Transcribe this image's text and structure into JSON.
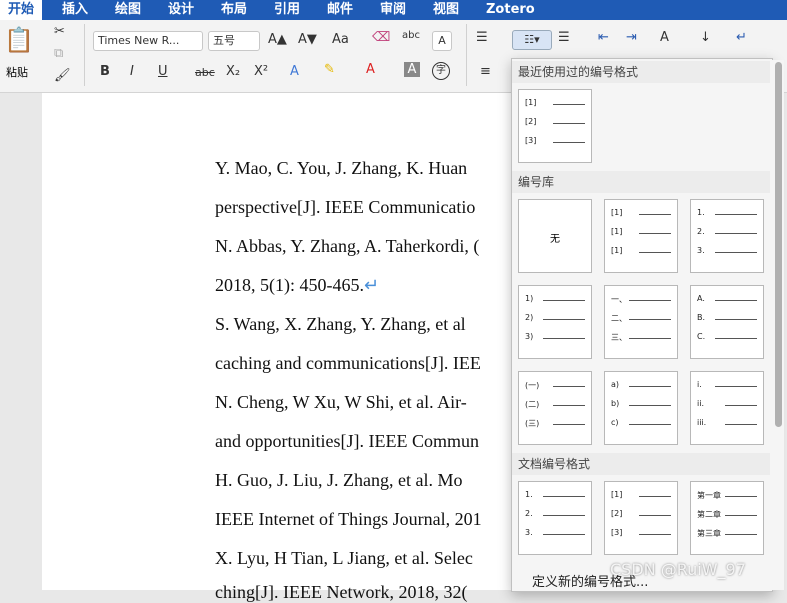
{
  "menu": {
    "tabs": [
      "开始",
      "插入",
      "绘图",
      "设计",
      "布局",
      "引用",
      "邮件",
      "审阅",
      "视图",
      "Zotero"
    ]
  },
  "ribbon": {
    "paste_label": "粘贴",
    "font_name": "Times New R...",
    "font_size": "五号",
    "bold": "B",
    "italic": "I",
    "underline": "U",
    "strike": "abc",
    "subscript": "X₂",
    "superscript": "X²",
    "grow": "A▲",
    "shrink": "A▼",
    "case": "Aa",
    "phonetic": "字"
  },
  "document": {
    "lines": [
      "Y. Mao, C. You, J. Zhang, K. Huan",
      "perspective[J]. IEEE Communicatio",
      "N. Abbas, Y. Zhang, A. Taherkordi, (",
      "2018, 5(1): 450-465.",
      "S. Wang, X. Zhang, Y. Zhang, et al",
      "caching and communications[J]. IEE",
      "N. Cheng, W Xu, W Shi, et al. Air-",
      "and opportunities[J]. IEEE Commun",
      "H. Guo, J. Liu, J. Zhang, et al. Mo",
      "IEEE Internet of Things Journal, 201",
      "X. Lyu, H Tian, L Jiang, et al. Selec",
      "ching[J]. IEEE Network, 2018, 32("
    ],
    "return_mark": "↵"
  },
  "dropdown": {
    "recent_title": "最近使用过的编号格式",
    "library_title": "编号库",
    "doc_title": "文档编号格式",
    "none_label": "无",
    "define_new": "定义新的编号格式...",
    "recent": [
      [
        "[1]",
        "[2]",
        "[3]"
      ]
    ],
    "library": [
      [
        "[1]",
        "[1]",
        "[1]"
      ],
      [
        "1.",
        "2.",
        "3."
      ],
      [
        "1)",
        "2)",
        "3)"
      ],
      [
        "一、",
        "二、",
        "三、"
      ],
      [
        "A.",
        "B.",
        "C."
      ],
      [
        "(一)",
        "(二)",
        "(三)"
      ],
      [
        "a)",
        "b)",
        "c)"
      ],
      [
        "i.",
        "ii.",
        "iii."
      ]
    ],
    "docformats": [
      [
        "1.",
        "2.",
        "3."
      ],
      [
        "[1]",
        "[2]",
        "[3]"
      ],
      [
        "第一章",
        "第二章",
        "第三章"
      ]
    ]
  },
  "watermark": "CSDN @RuiW_97"
}
